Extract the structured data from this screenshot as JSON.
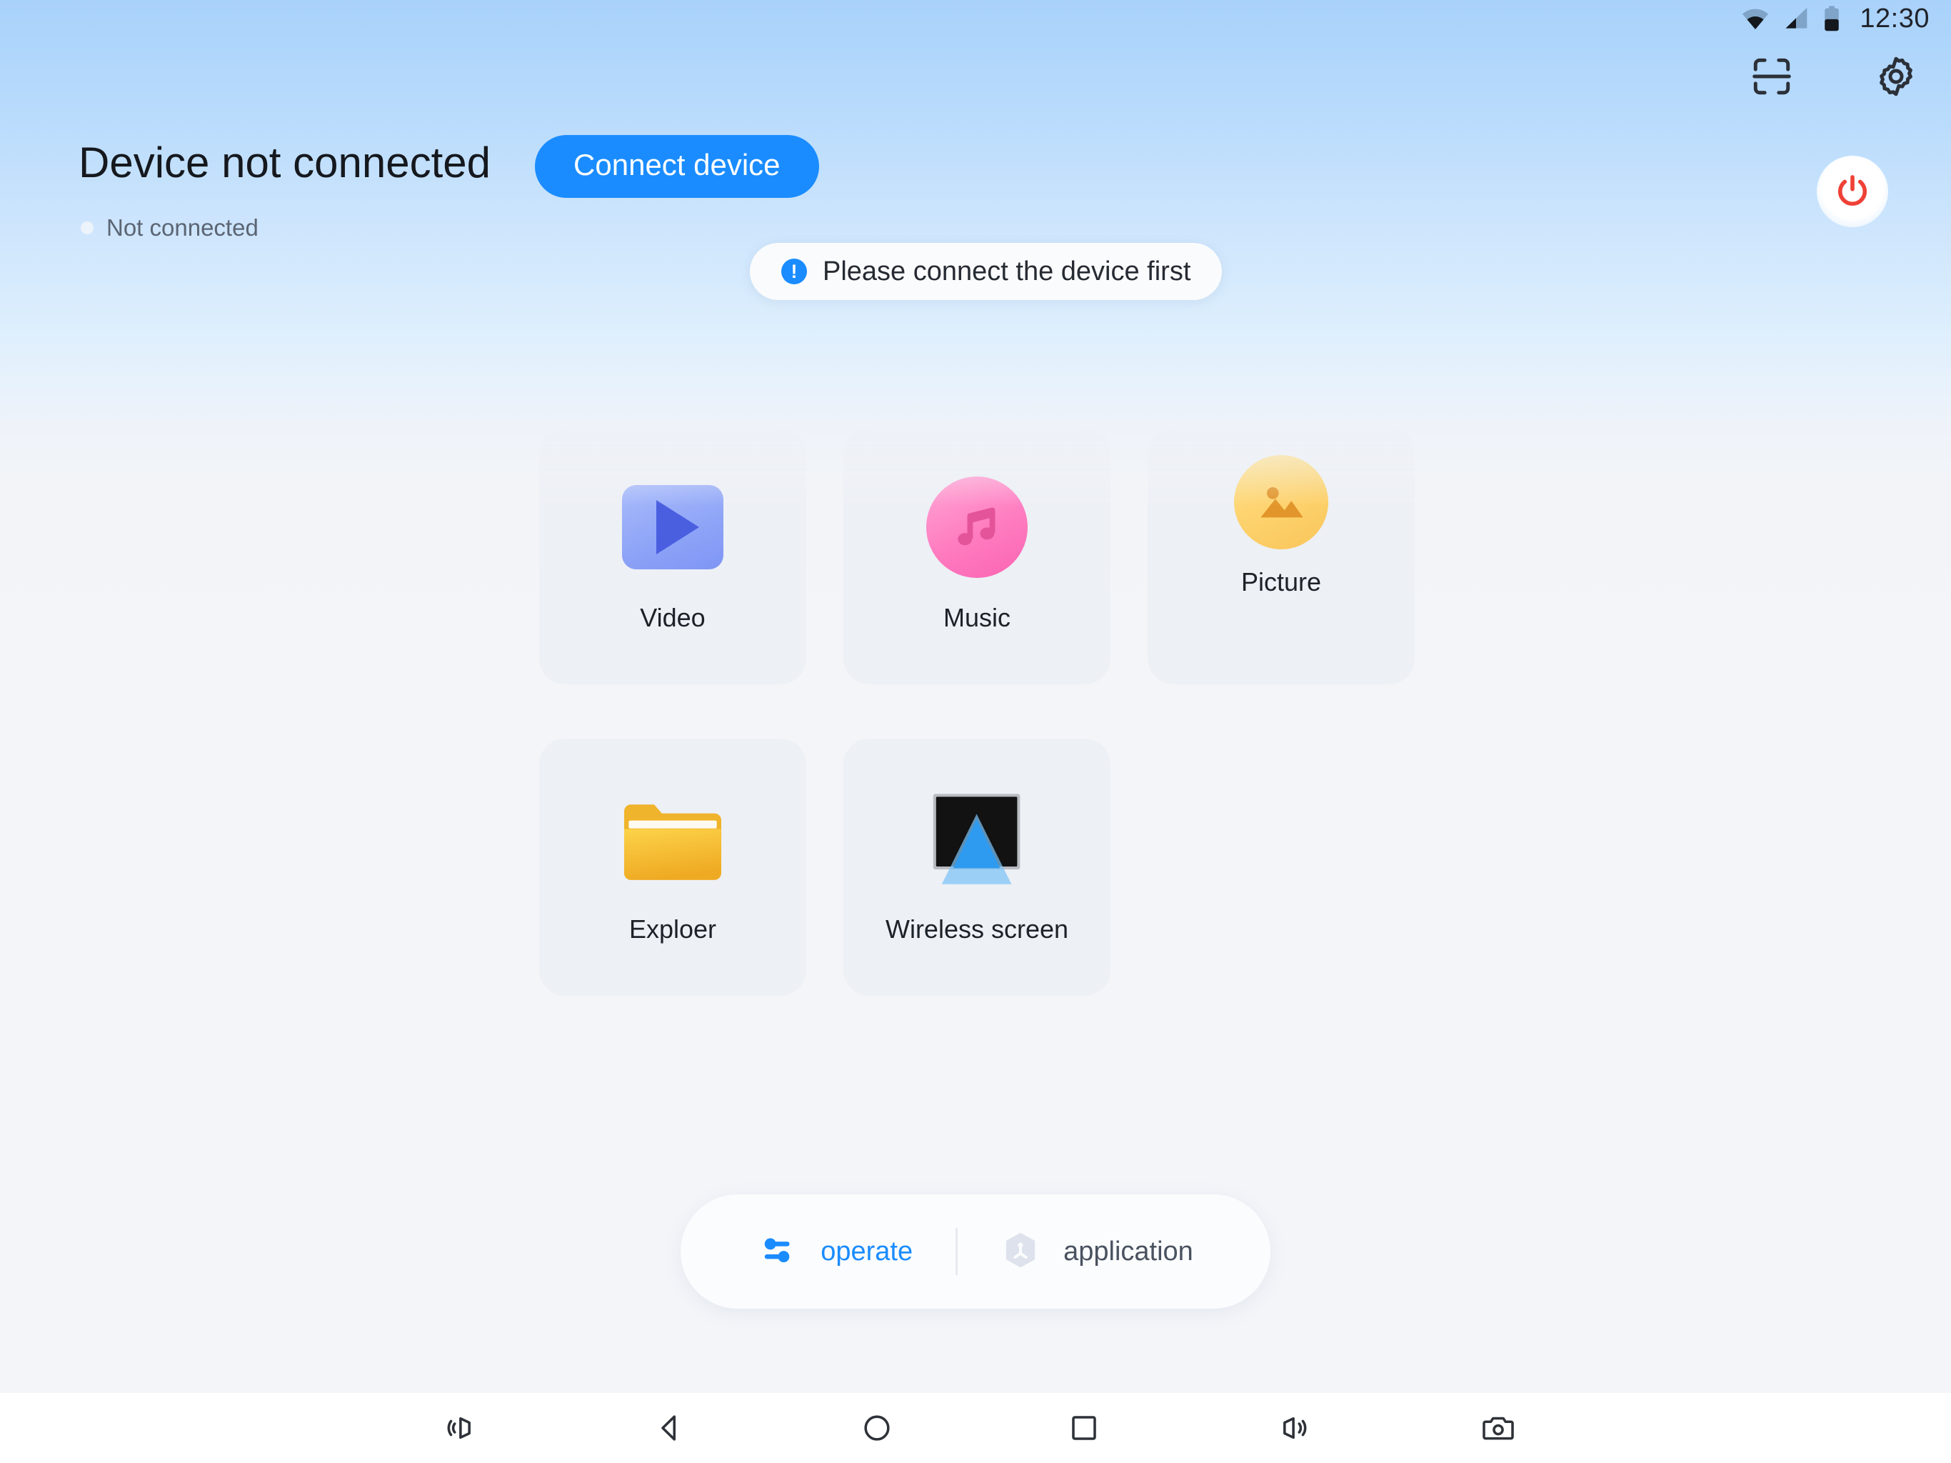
{
  "status_bar": {
    "time": "12:30",
    "icons": [
      "wifi-icon",
      "cellular-signal-icon",
      "battery-icon"
    ]
  },
  "top_actions": {
    "scan_icon": "scan-frame-icon",
    "settings_icon": "gear-icon",
    "power_icon": "power-icon",
    "power_color": "#ef4136"
  },
  "header": {
    "title": "Device not connected",
    "connect_button": "Connect device",
    "connect_button_color": "#1a8cff",
    "sub_status": "Not connected"
  },
  "toast": {
    "icon": "exclamation-circle-icon",
    "icon_glyph": "!",
    "message": "Please connect the device first"
  },
  "apps": [
    {
      "label": "Video",
      "icon": "video-play-icon",
      "color": "#8fa5f7"
    },
    {
      "label": "Music",
      "icon": "music-note-icon",
      "color": "#ff7cc0"
    },
    {
      "label": "Picture",
      "icon": "image-photo-icon",
      "color": "#fdd06a"
    },
    {
      "label": "Exploer",
      "icon": "folder-icon",
      "color": "#f5b728"
    },
    {
      "label": "Wireless screen",
      "icon": "cast-screen-icon",
      "color": "#2e9bf0"
    }
  ],
  "tabs": [
    {
      "label": "operate",
      "icon": "sliders-icon",
      "active": true,
      "color": "#1a8cff"
    },
    {
      "label": "application",
      "icon": "app-hex-icon",
      "active": false,
      "color": "#4a5260"
    }
  ],
  "nav_bar": {
    "buttons": [
      {
        "name": "volume-down-icon"
      },
      {
        "name": "back-icon"
      },
      {
        "name": "home-icon"
      },
      {
        "name": "recents-icon"
      },
      {
        "name": "volume-up-icon"
      },
      {
        "name": "screenshot-camera-icon"
      }
    ]
  }
}
